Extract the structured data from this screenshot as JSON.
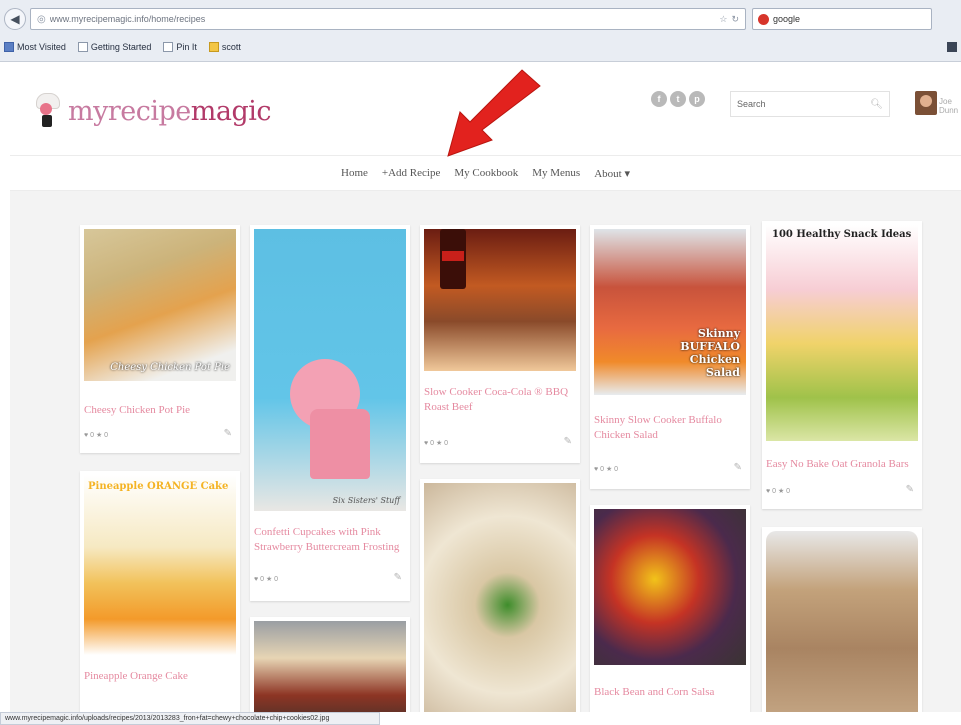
{
  "browser": {
    "back_icon": "back-arrow-icon",
    "url": "www.myrecipemagic.info/home/recipes",
    "search_engine_text": "google",
    "bookmarks": [
      {
        "label": "Most Visited",
        "icon": "folder-icon"
      },
      {
        "label": "Getting Started",
        "icon": "page-icon"
      },
      {
        "label": "Pin It",
        "icon": "pin-icon"
      },
      {
        "label": "scott",
        "icon": "folder-icon"
      }
    ],
    "status_url": "www.myrecipemagic.info/uploads/recipes/2013/2013283_fron+fat=chewy+chocolate+chip+cookies02.jpg"
  },
  "site": {
    "logo_prefix": "my",
    "logo_recipe": "recipe",
    "logo_magic": "magic",
    "social": [
      "f",
      "t",
      "p"
    ],
    "search_placeholder": "Search",
    "search_icon": "magnifier-icon",
    "avatar_name": "Joe Dunn"
  },
  "nav": {
    "items": [
      "Home",
      "+Add Recipe",
      "My Cookbook",
      "My Menus",
      "About ▾"
    ]
  },
  "annotation": {
    "arrow_color": "#e2221e"
  },
  "recipes": [
    {
      "title": "Cheesy Chicken Pot Pie",
      "meta": "♥ 0   ★ 0",
      "caption": "Cheesy Chicken Pot Pie"
    },
    {
      "title": "Pineapple Orange Cake",
      "meta": "",
      "caption": "Pineapple ORANGE Cake"
    },
    {
      "title": "Confetti Cupcakes with Pink Strawberry Buttercream Frosting",
      "meta": "♥ 0   ★ 0",
      "caption": "Six Sisters' Stuff"
    },
    {
      "title": "Slow Cooker Coca-Cola ® BBQ Roast Beef",
      "meta": "♥ 0   ★ 0",
      "caption": ""
    },
    {
      "title": "Skinny Slow Cooker Buffalo Chicken Salad",
      "meta": "♥ 0   ★ 0",
      "caption": "Skinny BUFFALO Chicken Salad"
    },
    {
      "title": "Black Bean and Corn Salsa",
      "meta": "",
      "caption": ""
    },
    {
      "title": "Easy No Bake Oat Granola Bars",
      "meta": "♥ 0   ★ 0",
      "caption": "100 Healthy Snack Ideas"
    }
  ]
}
